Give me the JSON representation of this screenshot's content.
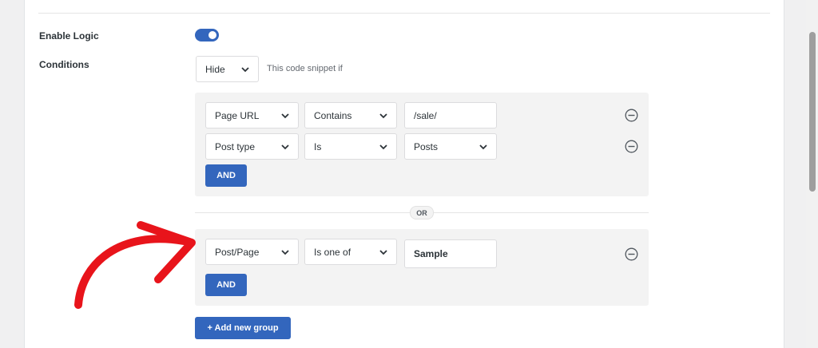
{
  "settings": {
    "enable_logic_label": "Enable Logic",
    "conditions_label": "Conditions",
    "toggle_on": true
  },
  "action": {
    "selected": "Hide",
    "helper_text": "This code snippet if"
  },
  "group1": {
    "rows": [
      {
        "field": "Page URL",
        "operator": "Contains",
        "value": "/sale/"
      },
      {
        "field": "Post type",
        "operator": "Is",
        "value": "Posts"
      }
    ],
    "and_label": "AND"
  },
  "or_label": "OR",
  "group2": {
    "rows": [
      {
        "field": "Post/Page",
        "operator": "Is one of",
        "value": "Sample"
      }
    ],
    "and_label": "AND"
  },
  "add_group_label": "+ Add new group",
  "colors": {
    "accent": "#3366bd",
    "arrow": "#e8141b"
  }
}
